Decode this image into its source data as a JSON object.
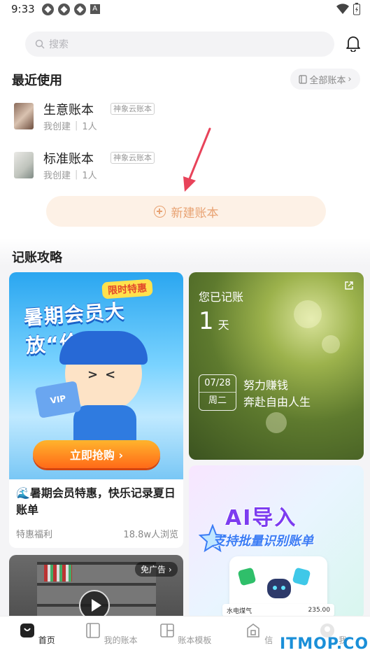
{
  "status_bar": {
    "time": "9:33"
  },
  "search": {
    "placeholder": "搜索"
  },
  "recent": {
    "title": "最近使用",
    "all_books_label": "全部账本",
    "books": [
      {
        "name": "生意账本",
        "tag": "神象云账本",
        "creator": "我创建",
        "members": "1人"
      },
      {
        "name": "标准账本",
        "tag": "神象云账本",
        "creator": "我创建",
        "members": "1人"
      }
    ]
  },
  "new_book_label": "新建账本",
  "guide": {
    "title": "记账攻略",
    "promo": {
      "badge": "限时特惠",
      "headline": "暑期会员大放“价”",
      "vip_text": "VIP",
      "button": "立即抢购 ›",
      "description": "🌊暑期会员特惠，快乐记录夏日账单",
      "category": "特惠福利",
      "views": "18.8w人浏览"
    },
    "record": {
      "label": "您已记账",
      "days": "1",
      "unit": "天",
      "date": "07/28",
      "weekday": "周二",
      "motto_line1": "努力赚钱",
      "motto_line2": "奔赴自由人生"
    },
    "ai": {
      "title": "AI导入",
      "subtitle": "支持批量识别账单",
      "row_label": "水电煤气",
      "row_amount": "235.00"
    },
    "video": {
      "no_ad_label": "免广告 ›"
    }
  },
  "tabs": [
    {
      "label": "首页",
      "icon": "home-icon",
      "active": true
    },
    {
      "label": "我的账本",
      "icon": "book-icon",
      "active": false
    },
    {
      "label": "账本模板",
      "icon": "template-icon",
      "active": false
    },
    {
      "label": "信",
      "icon": "bag-icon",
      "active": false
    },
    {
      "label": "我",
      "icon": "profile-icon",
      "active": false
    }
  ],
  "watermark": "ITMOP.COM",
  "colors": {
    "accent": "#e8a272",
    "arrow": "#e8435a",
    "tab_active": "#222222"
  }
}
